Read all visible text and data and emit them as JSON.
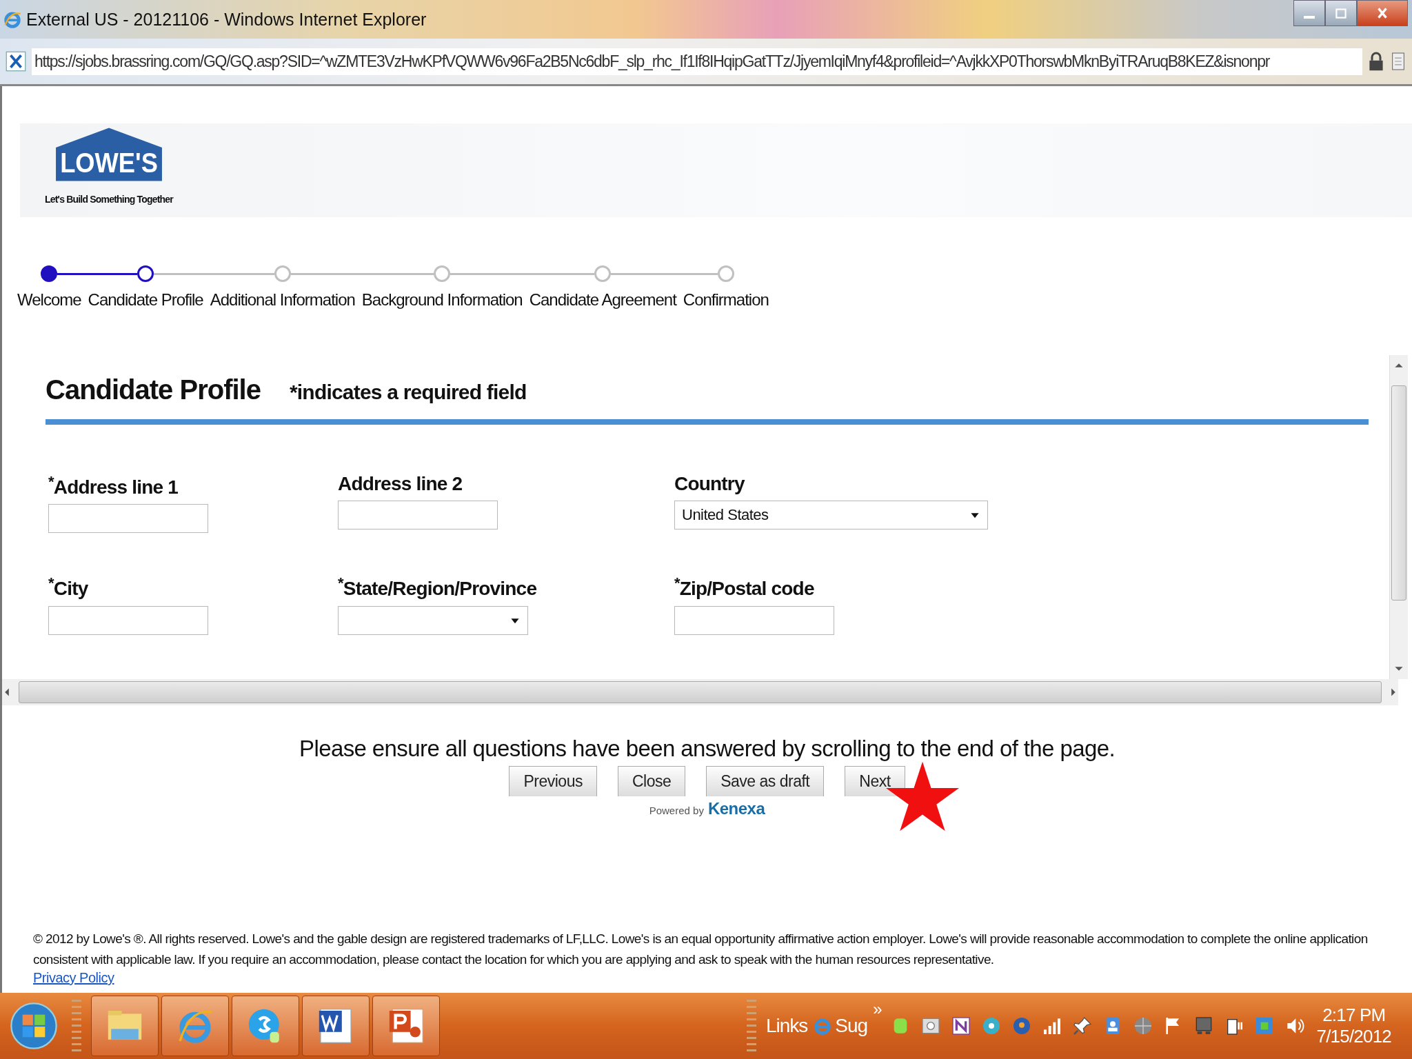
{
  "window": {
    "title": "External US - 20121106 - Windows Internet Explorer"
  },
  "address_bar": {
    "url": "https://sjobs.brassring.com/GQ/GQ.asp?SID=^wZMTE3VzHwKPfVQWW6v96Fa2B5Nc6dbF_slp_rhc_If1If8IHqipGatTTz/JjyemIqiMnyf4&profileid=^AvjkkXP0ThorswbMknByiTRAruqB8KEZ&isnonpr"
  },
  "header": {
    "logo_text": "LOWE'S",
    "tagline": "Let's Build Something Together"
  },
  "progress": {
    "steps": [
      {
        "label": "Welcome",
        "completed": true,
        "selected": false
      },
      {
        "label": "Candidate Profile",
        "completed": false,
        "selected": true
      },
      {
        "label": "Additional Information",
        "completed": false,
        "selected": false
      },
      {
        "label": "Background Information",
        "completed": false,
        "selected": false
      },
      {
        "label": "Candidate Agreement",
        "completed": false,
        "selected": false
      },
      {
        "label": "Confirmation",
        "completed": false,
        "selected": false
      }
    ]
  },
  "form": {
    "title": "Candidate Profile",
    "required_note": "*indicates a required field",
    "fields": [
      {
        "label": "$^{*}$Address line 1",
        "kind": "text"
      },
      {
        "label": "Address line 2",
        "kind": "text"
      },
      {
        "label": "Country",
        "kind": "select",
        "value": "United States"
      },
      {
        "label": "$^{*}$City",
        "kind": "text"
      },
      {
        "label": "$^{*}$State/Region/Province",
        "kind": "select"
      },
      {
        "label": "$^{*}$Zip/Postal code",
        "kind": "text"
      }
    ]
  },
  "message": "Please ensure all questions have been answered by scrolling to the end of the page.",
  "buttons": [
    "Previous",
    "Close",
    "Save as draft",
    "Next"
  ],
  "powered_by": {
    "prefix": "Powered by",
    "brand": "Kenexa"
  },
  "footer": {
    "text": "© 2012 by Lowe's ®. All rights reserved. Lowe's and the gable design are registered trademarks of LF,LLC. Lowe's is an equal opportunity affirmative action employer. Lowe's will provide reasonable accommodation to complete the online application consistent with applicable law. If you require an accommodation, please contact the location for which you are applying and ask to speak with the human resources representative.",
    "link": "Privacy Policy"
  },
  "taskbar": {
    "apps": [
      {
        "kind": "folder"
      },
      {
        "kind": "browser"
      },
      {
        "kind": "skype"
      },
      {
        "kind": "word"
      },
      {
        "kind": "powerpoint"
      }
    ],
    "toolbar_label": "Links",
    "toolbar_item": "Sug",
    "overflow": "»",
    "time": "2:17 PM",
    "date": "7/15/2012"
  }
}
